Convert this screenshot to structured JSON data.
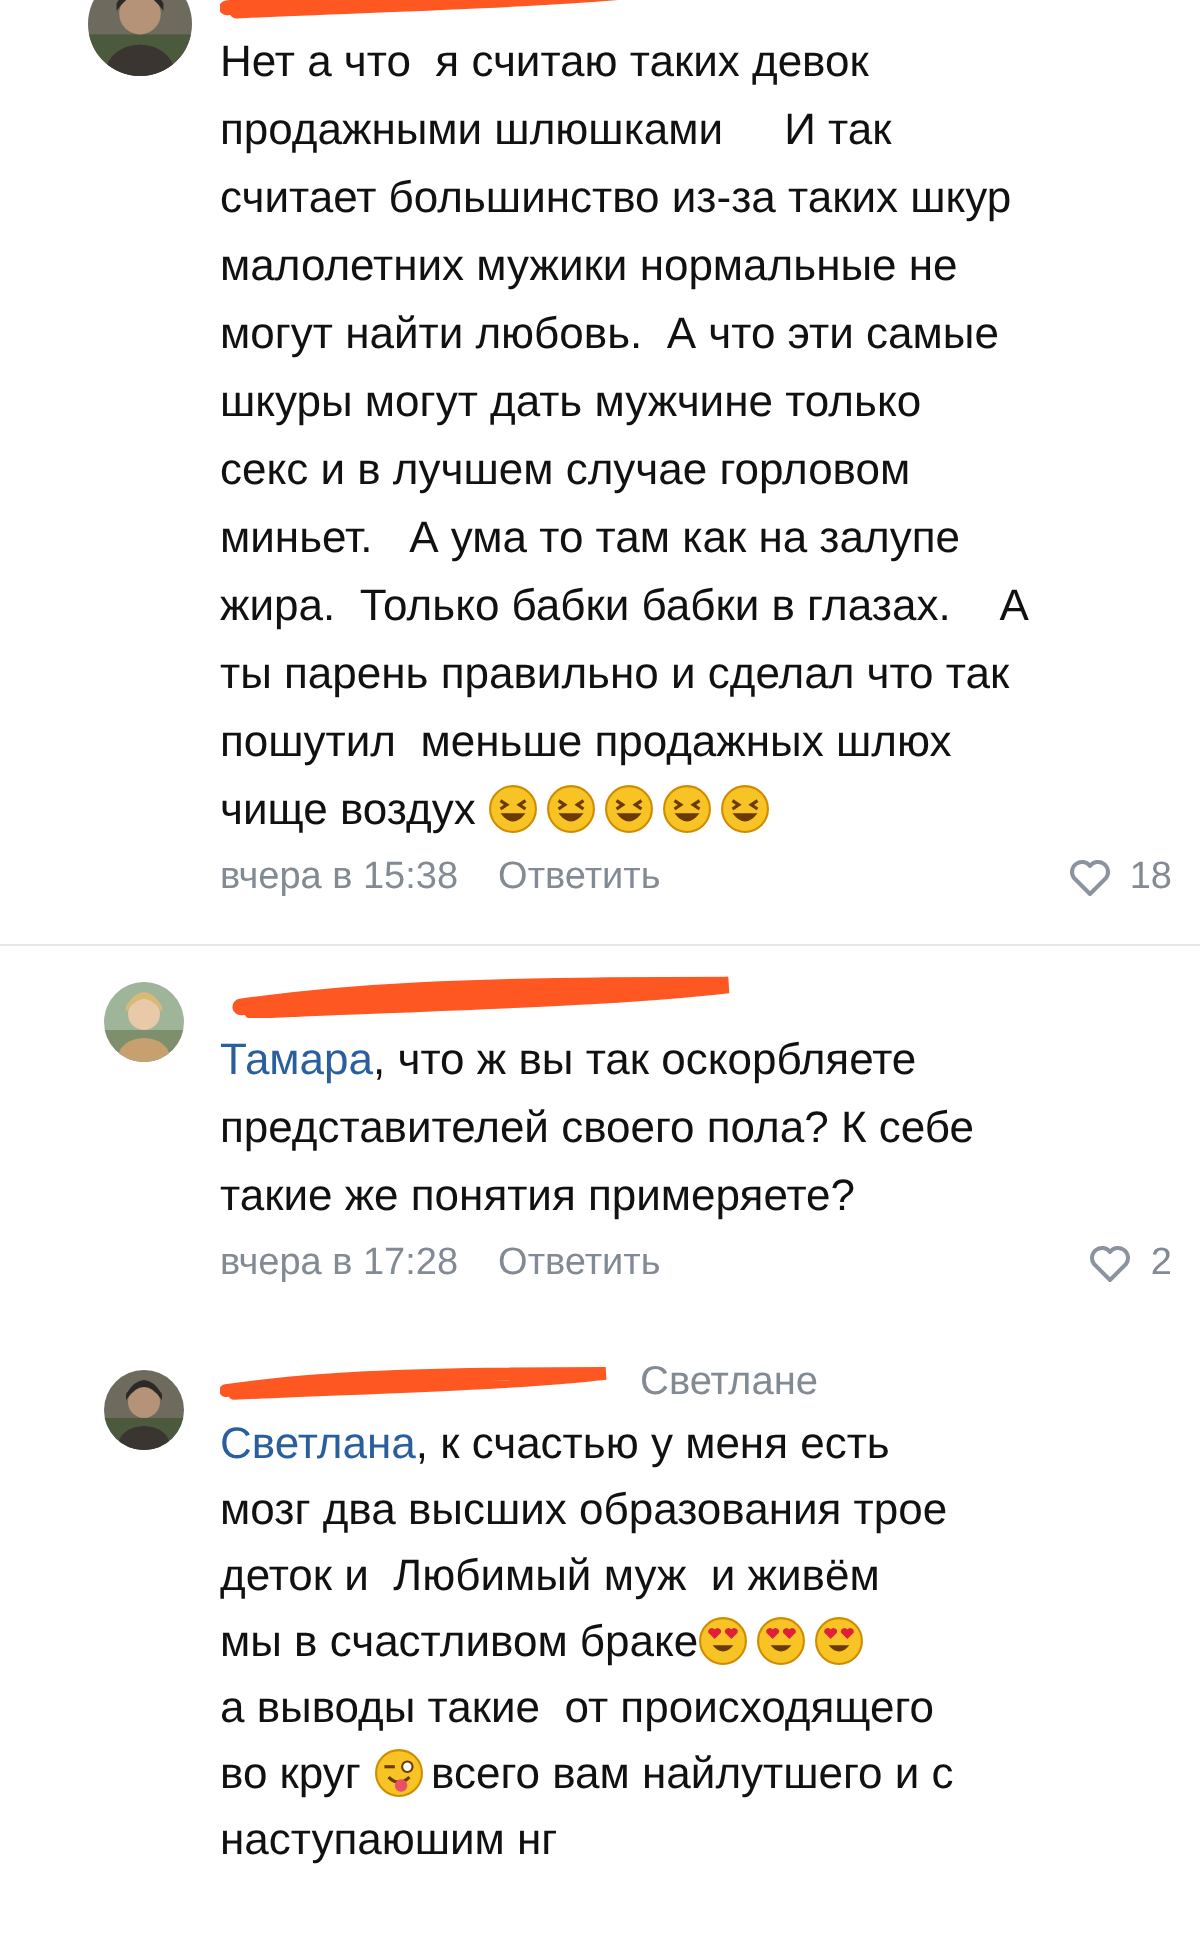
{
  "comments": [
    {
      "body": [
        {
          "kind": "text",
          "text": "Нет а что  я считаю таких девок\nпродажными шлюшками     И так\nсчитает большинство из-за таких шкур\nмалолетних мужики нормальные не\nмогут найти любовь.  А что эти самые\nшкуры могут дать мужчине только\nсекс и в лучшем случае горловом\nминьет.   А ума то там как на залупе\nжира.  Только бабки бабки в глазах.    А\nты парень правильно и сделал что так\nпошутил  меньше продажных шлюх\nчище воздух "
        },
        {
          "kind": "laugh"
        },
        {
          "kind": "laugh"
        },
        {
          "kind": "laugh"
        },
        {
          "kind": "laugh"
        },
        {
          "kind": "laugh"
        }
      ],
      "time": "вчера в 15:38",
      "reply": "Ответить",
      "likes": "18"
    },
    {
      "body": [
        {
          "kind": "mention",
          "text": "Тамара"
        },
        {
          "kind": "text",
          "text": ", что ж вы так оскорбляете\nпредставителей своего пола? К себе\nтакие же понятия примеряете?"
        }
      ],
      "time": "вчера в 17:28",
      "reply": "Ответить",
      "likes": "2"
    },
    {
      "reply_to": "Светлане",
      "body": [
        {
          "kind": "mention",
          "text": "Светлана"
        },
        {
          "kind": "text",
          "text": ", к счастью у меня есть\nмозг два высших образования трое\nдеток и  Любимый муж  и живём\nмы в счастливом браке"
        },
        {
          "kind": "hearts"
        },
        {
          "kind": "hearts"
        },
        {
          "kind": "hearts"
        },
        {
          "kind": "text",
          "text": "\nа выводы такие  от происходящего\nво круг "
        },
        {
          "kind": "wink"
        },
        {
          "kind": "text",
          "text": "всего вам найлутшего и с\nнаступаюшим нг"
        }
      ]
    }
  ]
}
